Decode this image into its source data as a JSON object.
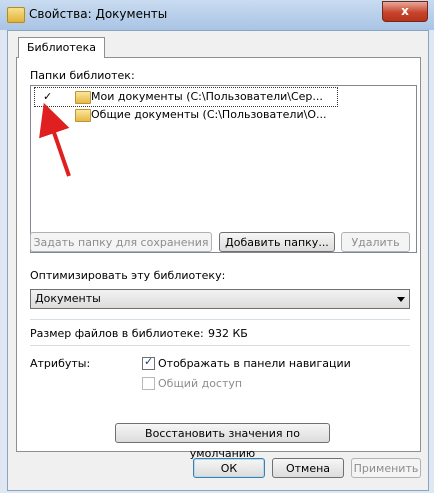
{
  "window": {
    "title": "Свойства: Документы",
    "close_glyph": "x"
  },
  "tabs": [
    {
      "label": "Библиотека"
    }
  ],
  "library_folders": {
    "label": "Папки библиотек:",
    "items": [
      {
        "check": "✓",
        "name": "Мои документы (C:\\Пользователи\\Сер..."
      },
      {
        "check": "",
        "name": "Общие документы (C:\\Пользователи\\О..."
      }
    ]
  },
  "folder_buttons": {
    "set_save": "Задать папку для сохранения",
    "add": "Добавить папку...",
    "remove": "Удалить"
  },
  "optimize": {
    "label": "Оптимизировать эту библиотеку:",
    "selected": "Документы"
  },
  "size": {
    "label": "Размер файлов в библиотеке:",
    "value": "932 КБ"
  },
  "attributes": {
    "label": "Атрибуты:",
    "show_in_nav": {
      "label": "Отображать в панели навигации",
      "checked_glyph": "✓"
    },
    "shared": {
      "label": "Общий доступ"
    }
  },
  "restore_button": "Восстановить значения по умолчанию",
  "dialog_buttons": {
    "ok": "ОК",
    "cancel": "Отмена",
    "apply": "Применить"
  },
  "colors": {
    "arrow": "#e02020"
  }
}
